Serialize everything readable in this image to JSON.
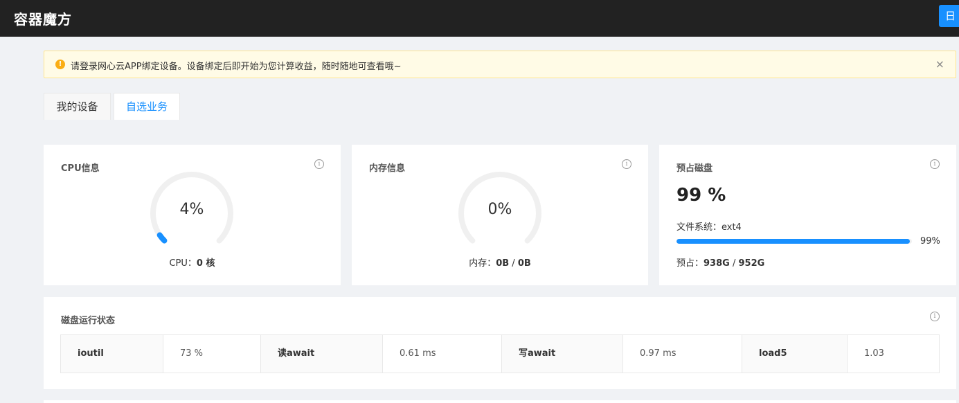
{
  "app": {
    "brand": "容器魔方",
    "top_button_label": "日"
  },
  "alert": {
    "message": "请登录网心云APP绑定设备。设备绑定后即开始为您计算收益，随时随地可查看哦~",
    "close_glyph": "×"
  },
  "tabs": [
    {
      "label": "我的设备",
      "active": false
    },
    {
      "label": "自选业务",
      "active": true
    }
  ],
  "cpu": {
    "title": "CPU信息",
    "percent": 4,
    "percent_label": "4%",
    "caption_prefix": "CPU：",
    "caption_value": "0 核"
  },
  "memory": {
    "title": "内存信息",
    "percent": 0,
    "percent_label": "0%",
    "caption_prefix": "内存：",
    "used": "0B",
    "separator": " / ",
    "total": "0B"
  },
  "disk": {
    "title": "预占磁盘",
    "percent": 99,
    "percent_label": "99 %",
    "filesystem_label": "文件系统：ext4",
    "bar_label": "99%",
    "used_prefix": "预占：",
    "used": "938G",
    "separator": " / ",
    "total": "952G"
  },
  "disk_status": {
    "title": "磁盘运行状态",
    "stats": [
      {
        "key": "ioutil",
        "value": "73 %"
      },
      {
        "key": "读await",
        "value": "0.61 ms"
      },
      {
        "key": "写await",
        "value": "0.97 ms"
      },
      {
        "key": "load5",
        "value": "1.03"
      }
    ]
  },
  "colors": {
    "accent": "#1890ff",
    "topbar": "#222222",
    "alert_bg": "#fffbe6",
    "alert_icon": "#faad14",
    "gauge_track": "#f0f0f0"
  },
  "icons": {
    "info": "info-circle-icon",
    "alert": "exclamation-circle-icon",
    "close": "close-icon"
  }
}
